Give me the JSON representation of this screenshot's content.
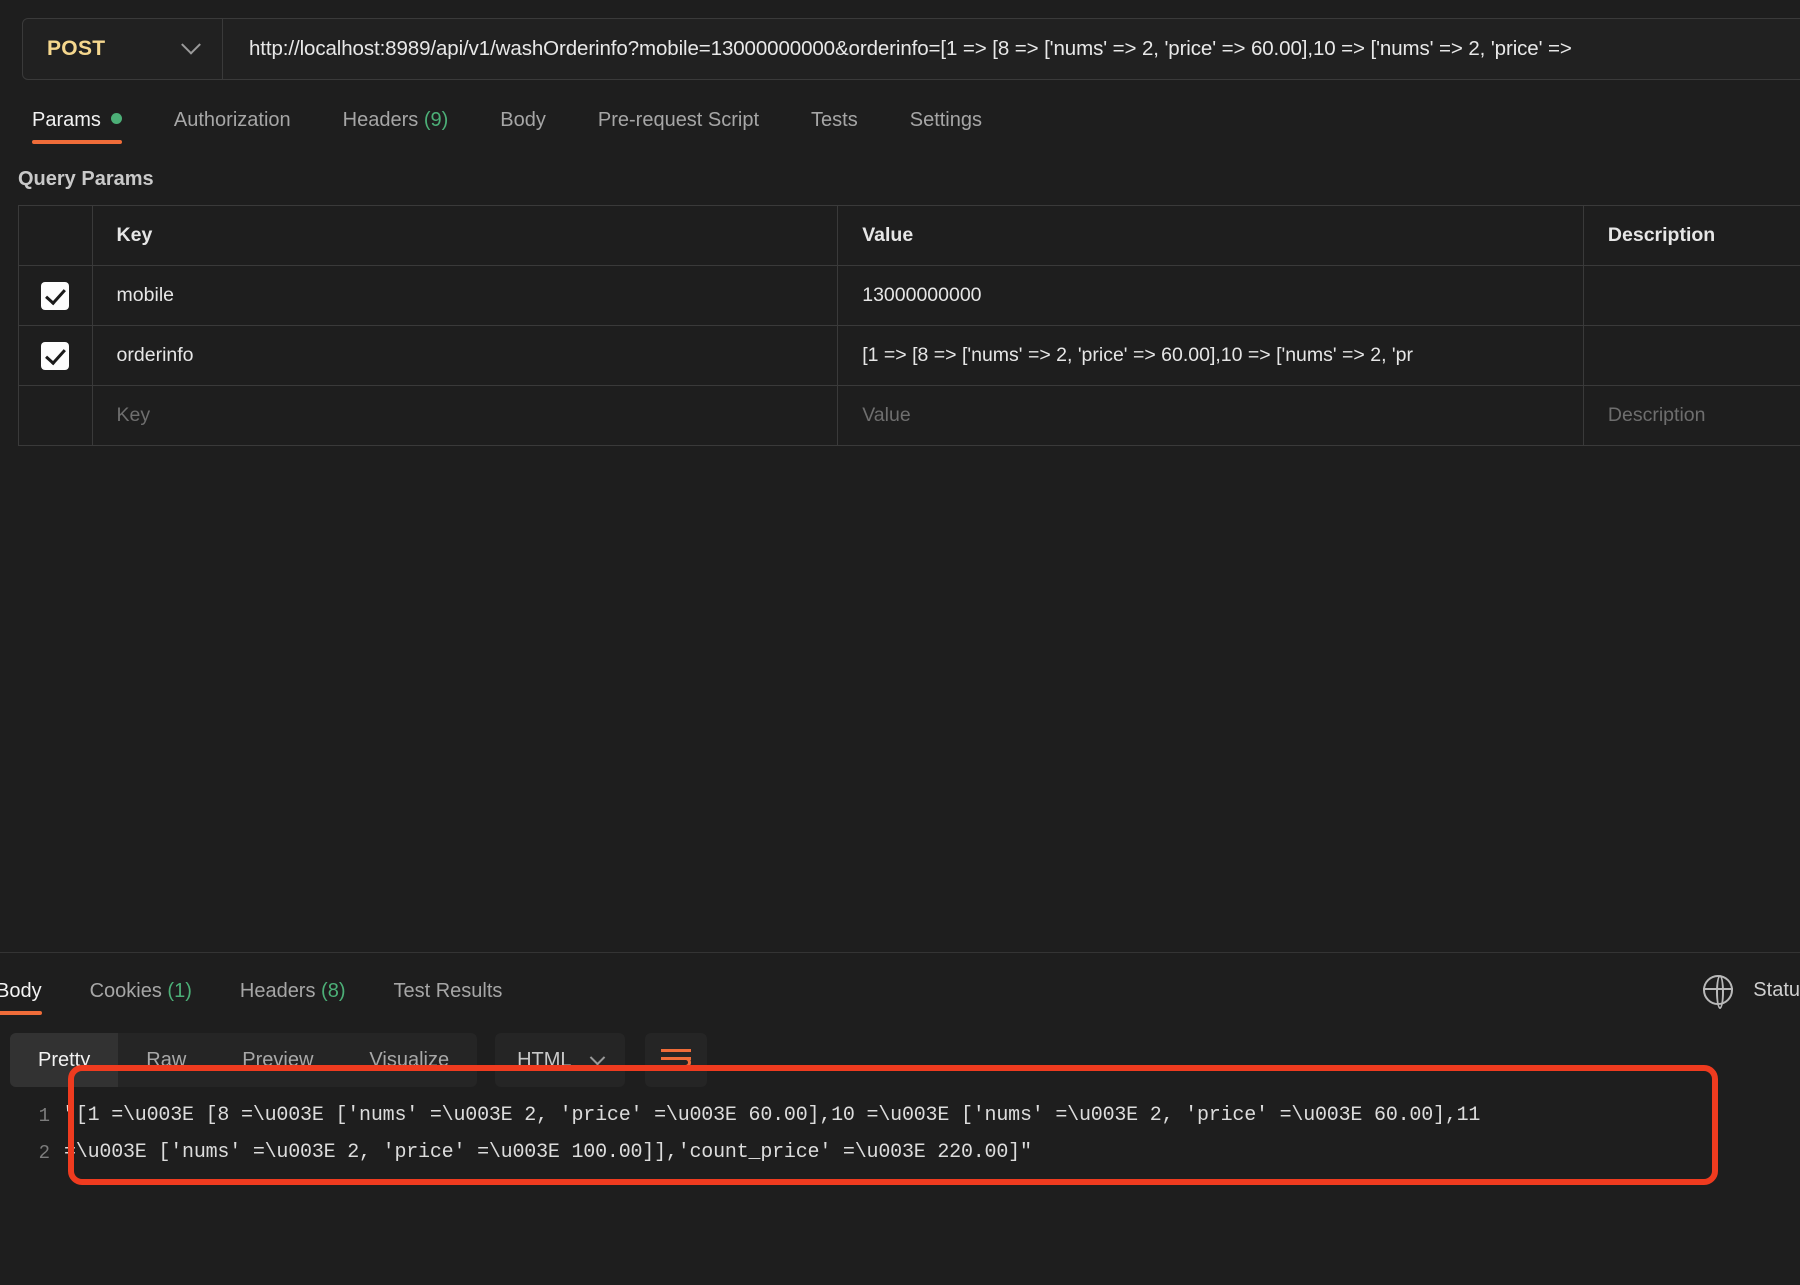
{
  "request": {
    "method": "POST",
    "url": "http://localhost:8989/api/v1/washOrderinfo?mobile=13000000000&orderinfo=[1 => [8 => ['nums' => 2, 'price' => 60.00],10 => ['nums' => 2, 'price' =>",
    "tabs": [
      {
        "label": "Params",
        "dot": true,
        "active": true
      },
      {
        "label": "Authorization",
        "active": false
      },
      {
        "label": "Headers",
        "count": "(9)",
        "active": false
      },
      {
        "label": "Body",
        "active": false
      },
      {
        "label": "Pre-request Script",
        "active": false
      },
      {
        "label": "Tests",
        "active": false
      },
      {
        "label": "Settings",
        "active": false
      }
    ]
  },
  "query_params": {
    "section_title": "Query Params",
    "columns": [
      "Key",
      "Value",
      "Description"
    ],
    "rows": [
      {
        "checked": true,
        "key": "mobile",
        "value": "13000000000",
        "description": ""
      },
      {
        "checked": true,
        "key": "orderinfo",
        "value": "[1 => [8 => ['nums' => 2, 'price' => 60.00],10 => ['nums' => 2, 'pr",
        "description": ""
      }
    ],
    "placeholder_row": {
      "key": "Key",
      "value": "Value",
      "description": "Description"
    }
  },
  "response": {
    "tabs": [
      {
        "label": "Body",
        "active": true
      },
      {
        "label": "Cookies",
        "count": "(1)",
        "active": false
      },
      {
        "label": "Headers",
        "count": "(8)",
        "active": false
      },
      {
        "label": "Test Results",
        "active": false
      }
    ],
    "status_text": "Statu",
    "viewer_tabs": [
      {
        "label": "Pretty",
        "active": true
      },
      {
        "label": "Raw",
        "active": false
      },
      {
        "label": "Preview",
        "active": false
      },
      {
        "label": "Visualize",
        "active": false
      }
    ],
    "language": "HTML",
    "body_lines": [
      {
        "no": "1",
        "text": "\"[1 =\\u003E [8 =\\u003E ['nums' =\\u003E 2, 'price' =\\u003E 60.00],10 =\\u003E ['nums' =\\u003E 2, 'price' =\\u003E 60.00],11"
      },
      {
        "no": "2",
        "text": "=\\u003E ['nums' =\\u003E 2, 'price' =\\u003E 100.00]],'count_price' =\\u003E 220.00]\""
      }
    ]
  },
  "colors": {
    "accent": "#ef6c39",
    "annotation": "#ef3b1f",
    "method": "#f5d78e",
    "count": "#4caf77"
  }
}
